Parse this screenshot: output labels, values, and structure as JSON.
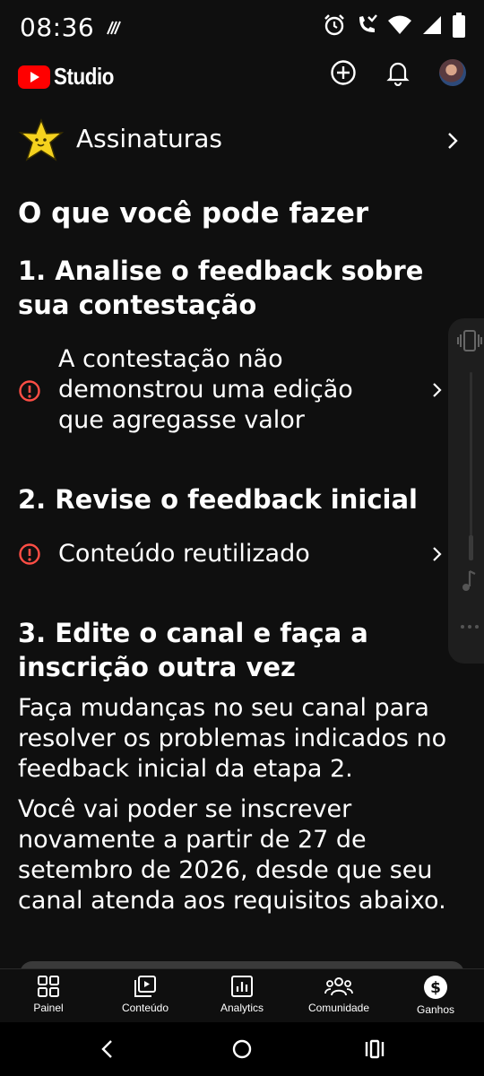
{
  "status": {
    "time": "08:36"
  },
  "app": {
    "brand": "Studio"
  },
  "subscriptions_row": {
    "label": "Assinaturas"
  },
  "main": {
    "heading": "O que você pode fazer",
    "step1": {
      "title": "1. Analise o feedback sobre sua contestação",
      "item": "A contestação não demonstrou uma edição que agregasse valor"
    },
    "step2": {
      "title": "2. Revise o feedback inicial",
      "item": "Conteúdo reutilizado"
    },
    "step3": {
      "title": "3. Edite o canal e faça a inscrição outra vez",
      "para1": "Faça mudanças no seu canal para resolver os problemas indicados no feedback inicial da etapa 2.",
      "para2": "Você vai poder se inscrever novamente a partir de 27 de setembro de 2026, desde que seu canal atenda aos requisitos abaixo."
    }
  },
  "bottom_nav": {
    "items": [
      {
        "label": "Painel",
        "icon": "dashboard-icon"
      },
      {
        "label": "Conteúdo",
        "icon": "content-icon"
      },
      {
        "label": "Analytics",
        "icon": "analytics-icon"
      },
      {
        "label": "Comunidade",
        "icon": "community-icon"
      },
      {
        "label": "Ganhos",
        "icon": "earn-icon"
      }
    ]
  },
  "colors": {
    "background": "#0f0f0f",
    "alert": "#ff4e45",
    "brand": "#ff0000"
  }
}
